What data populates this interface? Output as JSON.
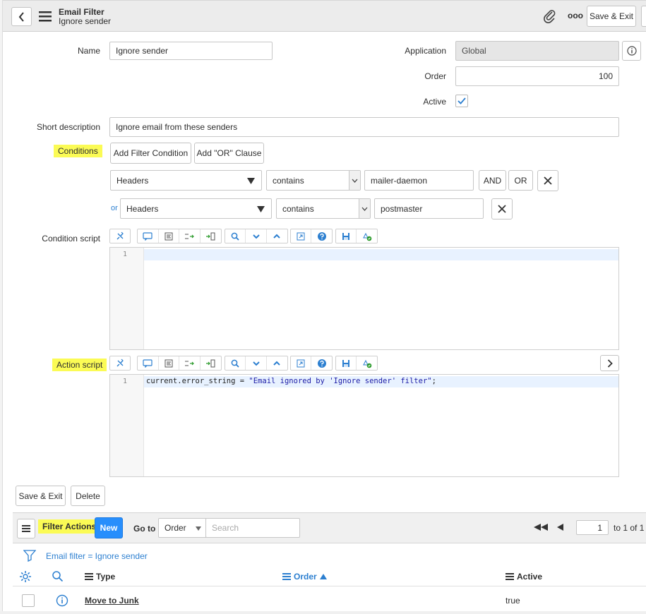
{
  "header": {
    "title": "Email Filter",
    "subtitle": "Ignore sender",
    "more_label": "ooo",
    "save_exit": "Save & Exit"
  },
  "form": {
    "name_label": "Name",
    "name_value": "Ignore sender",
    "application_label": "Application",
    "application_value": "Global",
    "order_label": "Order",
    "order_value": "100",
    "active_label": "Active",
    "short_desc_label": "Short description",
    "short_desc_value": "Ignore email from these senders",
    "conditions_label": "Conditions",
    "add_filter_condition": "Add Filter Condition",
    "add_or_clause": "Add \"OR\" Clause",
    "cond1": {
      "field": "Headers",
      "operator": "contains",
      "value": "mailer-daemon",
      "and": "AND",
      "or": "OR"
    },
    "cond2": {
      "prefix": "or",
      "field": "Headers",
      "operator": "contains",
      "value": "postmaster"
    },
    "condition_script_label": "Condition script",
    "condition_script_lines": [
      "1"
    ],
    "action_script_label": "Action script",
    "action_script_lines": [
      "1"
    ],
    "action_code_prefix": "current.error_string = ",
    "action_code_string": "\"Email ignored by 'Ignore sender' filter\"",
    "action_code_suffix": ";"
  },
  "bottom_buttons": {
    "save_exit": "Save & Exit",
    "delete": "Delete"
  },
  "related_list": {
    "title": "Filter Actions",
    "new_label": "New",
    "goto_label": "Go to",
    "goto_field": "Order",
    "search_placeholder": "Search",
    "page_value": "1",
    "page_of": "to 1 of 1",
    "breadcrumb": "Email filter = Ignore sender",
    "columns": {
      "type": "Type",
      "order": "Order",
      "active": "Active"
    },
    "rows": [
      {
        "type": "Move to Junk",
        "order": "",
        "active": "true"
      }
    ]
  },
  "colors": {
    "accent": "#2c7fd0",
    "new_button": "#278efc",
    "highlight": "#fbfb55"
  }
}
